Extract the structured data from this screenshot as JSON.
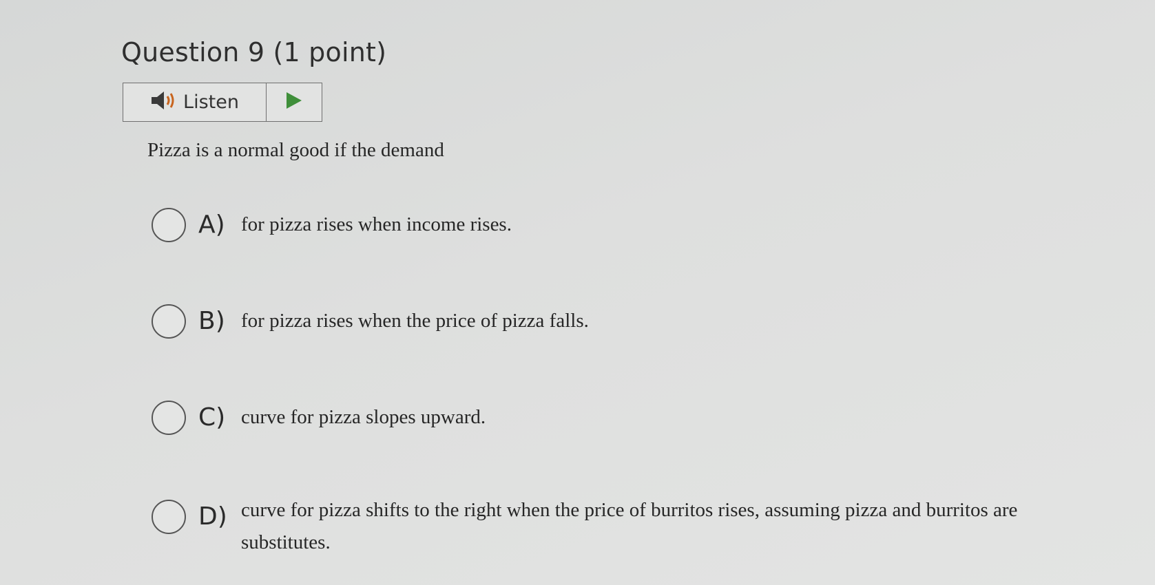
{
  "question": {
    "title": "Question 9 (1 point)",
    "listen_label": "Listen",
    "stem": "Pizza is a normal good if the demand"
  },
  "options": [
    {
      "letter": "A)",
      "text": "for pizza rises when income rises."
    },
    {
      "letter": "B)",
      "text": "for pizza rises when the price of pizza falls."
    },
    {
      "letter": "C)",
      "text": "curve for pizza slopes upward."
    },
    {
      "letter": "D)",
      "text": "curve for pizza shifts to the right when the price of burritos rises, assuming pizza and burritos are substitutes."
    }
  ],
  "icons": {
    "speaker": "speaker-icon",
    "play": "play-icon"
  },
  "colors": {
    "play_green": "#3f8f3a",
    "speaker_dark": "#3a3a3a",
    "speaker_wave": "#c8641e"
  }
}
